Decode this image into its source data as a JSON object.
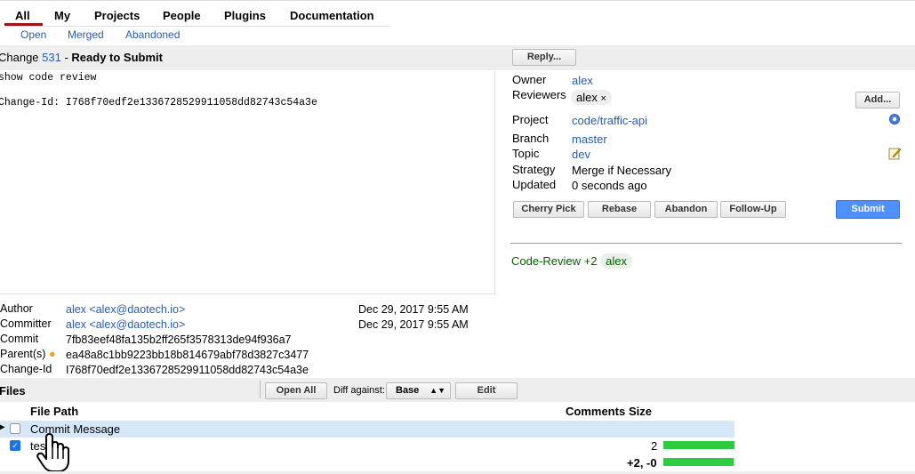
{
  "nav": {
    "tabs": [
      "All",
      "My",
      "Projects",
      "People",
      "Plugins",
      "Documentation"
    ],
    "subtabs": [
      "Open",
      "Merged",
      "Abandoned"
    ]
  },
  "change": {
    "prefix": "Change ",
    "number": "531",
    "sep": " - ",
    "status": "Ready to Submit",
    "reply_label": "Reply..."
  },
  "commit_message": {
    "line1": "show code review",
    "line2": "Change-Id: I768f70edf2e1336728529911058dd82743c54a3e"
  },
  "info": {
    "owner_label": "Owner",
    "owner": "alex",
    "reviewers_label": "Reviewers",
    "reviewer": "alex",
    "reviewer_remove": "×",
    "add_label": "Add...",
    "project_label": "Project",
    "project": "code/traffic-api",
    "branch_label": "Branch",
    "branch": "master",
    "topic_label": "Topic",
    "topic": "dev",
    "strategy_label": "Strategy",
    "strategy": "Merge if Necessary",
    "updated_label": "Updated",
    "updated": "0 seconds ago"
  },
  "actions": {
    "cherry_pick": "Cherry Pick",
    "rebase": "Rebase",
    "abandon": "Abandon",
    "follow_up": "Follow-Up",
    "submit": "Submit"
  },
  "votes": {
    "label": "Code-Review",
    "value": "+2",
    "user": "alex"
  },
  "meta": {
    "author_label": "Author",
    "author": "alex <alex@daotech.io>",
    "author_date": "Dec 29, 2017 9:55 AM",
    "committer_label": "Committer",
    "committer": "alex <alex@daotech.io>",
    "committer_date": "Dec 29, 2017 9:55 AM",
    "commit_label": "Commit",
    "commit": "7fb83eef48fa135b2ff265f3578313de94f936a7",
    "parents_label": "Parent(s)",
    "parent": "ea48a8c1bb9223bb18b814679abf78d3827c3477",
    "changeid_label": "Change-Id",
    "changeid": "I768f70edf2e1336728529911058dd82743c54a3e"
  },
  "files": {
    "label": "Files",
    "open_all": "Open All",
    "diff_against": "Diff against:",
    "diff_base": "Base",
    "edit": "Edit",
    "col_path": "File Path",
    "col_comments": "Comments",
    "col_size": "Size",
    "rows": [
      {
        "path": "Commit Message",
        "size": ""
      },
      {
        "path": "test.js",
        "size": "2"
      }
    ],
    "total": "+2, -0"
  },
  "colors": {
    "accent": "#a0131a",
    "link": "#2a5db0",
    "submit": "#4d90fe",
    "bar": "#2ecc40",
    "vote": "#006400"
  }
}
